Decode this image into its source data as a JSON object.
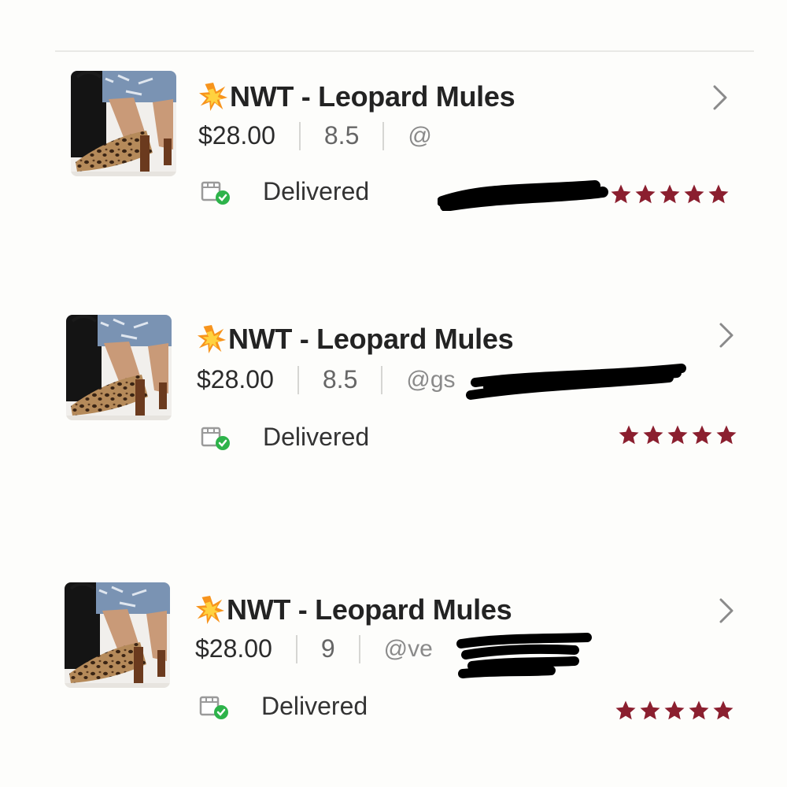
{
  "colors": {
    "star": "#8b1f2f",
    "delivered_check": "#2db34a",
    "background": "#fdfdfb"
  },
  "icons": {
    "title_prefix": "collision-burst-icon",
    "status": "package-delivered-icon",
    "navigation": "chevron-right-icon",
    "rating": "star-icon"
  },
  "orders": [
    {
      "title": "NWT - Leopard Mules",
      "price": "$28.00",
      "size": "8.5",
      "seller": "@",
      "status": "Delivered",
      "rating": 5
    },
    {
      "title": "NWT - Leopard Mules",
      "price": "$28.00",
      "size": "8.5",
      "seller": "@gs",
      "status": "Delivered",
      "rating": 5
    },
    {
      "title": "NWT - Leopard Mules",
      "price": "$28.00",
      "size": "9",
      "seller": "@ve",
      "status": "Delivered",
      "rating": 5
    }
  ]
}
